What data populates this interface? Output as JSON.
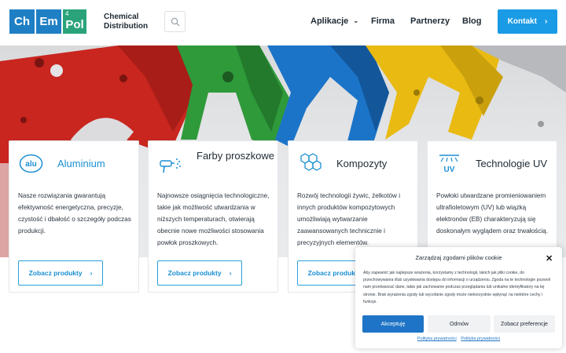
{
  "header": {
    "logo": {
      "cells": [
        {
          "symbol": "Ch"
        },
        {
          "symbol": "Em"
        },
        {
          "number": "4",
          "symbol": "Pol"
        }
      ]
    },
    "brand_line1": "Chemical",
    "brand_line2": "Distribution",
    "nav": {
      "applications": "Aplikacje",
      "company": "Firma",
      "partners": "Partnerzy",
      "blog": "Blog"
    },
    "contact_label": "Kontakt",
    "colors": {
      "accent": "#1a9be6",
      "logo_blue": "#1f7fc4",
      "logo_green": "#2aa37a"
    }
  },
  "cards": [
    {
      "icon": "aluminium-badge-icon",
      "icon_text": "alu",
      "title": "Aluminium",
      "description": "Nasze rozwiązania gwarantują efektywność energetyczna, precyzje, czystość i dbałość o szczegóły podczas produkcji.",
      "button": "Zobacz produkty"
    },
    {
      "icon": "spray-gun-icon",
      "title": "Farby proszkowe",
      "description": "Najnowsze osiągnięcia technologiczne, takie jak możliwość utwardzania w niższych temperaturach, otwierają obecnie nowe możliwości stosowania powłok proszkowych.",
      "button": "Zobacz produkty"
    },
    {
      "icon": "hexagon-molecule-icon",
      "title": "Kompozyty",
      "description": "Rozwój technologii żywic, żelkotów i innych produktów kompozytowych umożliwiają wytwarzanie zaawansowanych technicznie i precyzyjnych elementów.",
      "button": "Zobacz produkty"
    },
    {
      "icon": "uv-lamp-icon",
      "icon_text": "UV",
      "title": "Technologie UV",
      "description": "Powłoki utwardzane promieniowaniem ultrafioletowym (UV) lub wiązką elektronów (EB) charakteryzują się doskonałym wyglądem oraz trwałością."
    }
  ],
  "cookie": {
    "title": "Zarządzaj zgodami plików cookie",
    "text": "Aby zapewnić jak najlepsze wrażenia, korzystamy z technologii, takich jak pliki cookie, do przechowywania i/lub uzyskiwania dostępu do informacji o urządzeniu. Zgoda na te technologie pozwoli nam przetwarzać dane, takie jak zachowanie podczas przeglądania lub unikalne identyfikatory na tej stronie. Brak wyrażenia zgody lub wycofanie zgody może niekorzystnie wpłynąć na niektóre cechy i funkcje.",
    "accept": "Akceptuję",
    "deny": "Odmów",
    "preferences": "Zobacz preferencje",
    "privacy_link_1": "Polityka prywatności",
    "privacy_link_2": "Polityka prywatności"
  }
}
